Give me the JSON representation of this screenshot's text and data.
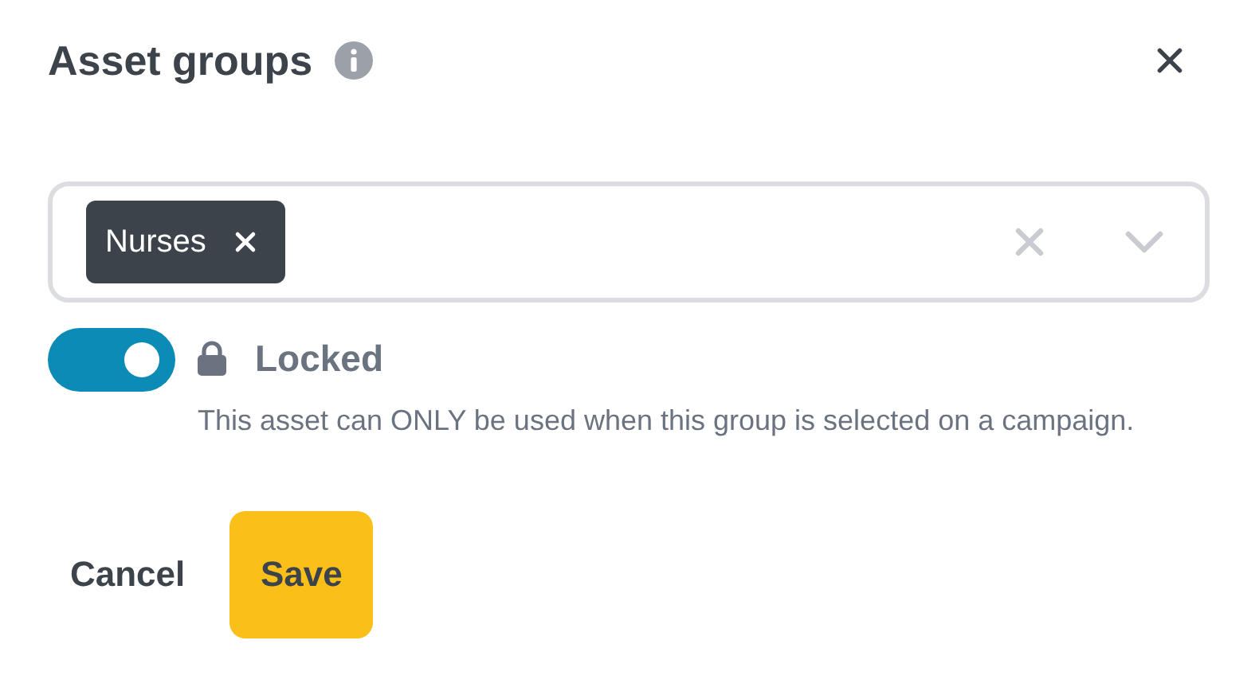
{
  "dialog": {
    "title": "Asset groups"
  },
  "select": {
    "chips": [
      {
        "label": "Nurses"
      }
    ]
  },
  "lock_toggle": {
    "on": true,
    "label": "Locked",
    "description": "This asset can ONLY be used when this group is selected on a campaign."
  },
  "buttons": [
    {
      "label": "Cancel",
      "kind": "secondary"
    },
    {
      "label": "Save",
      "kind": "primary"
    }
  ]
}
